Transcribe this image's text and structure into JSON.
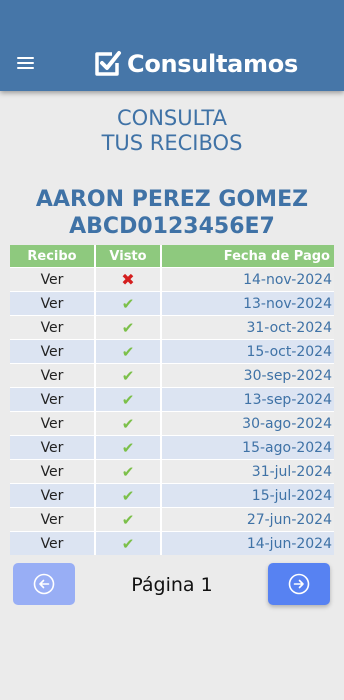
{
  "app": {
    "brand": "Consultamos",
    "accent": "#4676a8"
  },
  "heading": {
    "line1": "CONSULTA",
    "line2": "TUS RECIBOS"
  },
  "user": {
    "name": "AARON PEREZ GOMEZ",
    "id": "ABCD0123456E7"
  },
  "table": {
    "headers": [
      "Recibo",
      "Visto",
      "Fecha de Pago"
    ],
    "rows": [
      {
        "recibo": "Ver",
        "visto": false,
        "fecha": "14-nov-2024"
      },
      {
        "recibo": "Ver",
        "visto": true,
        "fecha": "13-nov-2024"
      },
      {
        "recibo": "Ver",
        "visto": true,
        "fecha": "31-oct-2024"
      },
      {
        "recibo": "Ver",
        "visto": true,
        "fecha": "15-oct-2024"
      },
      {
        "recibo": "Ver",
        "visto": true,
        "fecha": "30-sep-2024"
      },
      {
        "recibo": "Ver",
        "visto": true,
        "fecha": "13-sep-2024"
      },
      {
        "recibo": "Ver",
        "visto": true,
        "fecha": "30-ago-2024"
      },
      {
        "recibo": "Ver",
        "visto": true,
        "fecha": "15-ago-2024"
      },
      {
        "recibo": "Ver",
        "visto": true,
        "fecha": "31-jul-2024"
      },
      {
        "recibo": "Ver",
        "visto": true,
        "fecha": "15-jul-2024"
      },
      {
        "recibo": "Ver",
        "visto": true,
        "fecha": "27-jun-2024"
      },
      {
        "recibo": "Ver",
        "visto": true,
        "fecha": "14-jun-2024"
      }
    ]
  },
  "pagination": {
    "label": "Página 1",
    "prev_icon": "arrow-left-circle-icon",
    "next_icon": "arrow-right-circle-icon"
  }
}
